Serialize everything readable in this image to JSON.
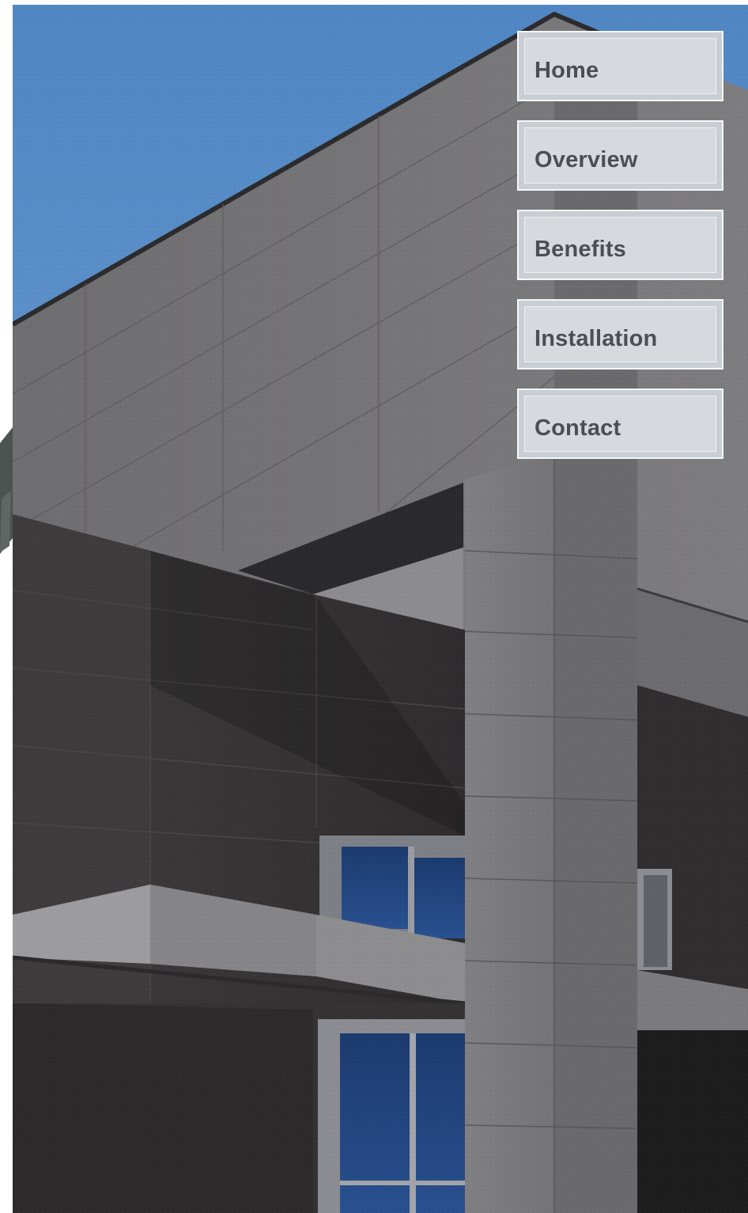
{
  "nav": {
    "items": [
      {
        "id": "home",
        "label": "Home"
      },
      {
        "id": "overview",
        "label": "Overview"
      },
      {
        "id": "benefits",
        "label": "Benefits"
      },
      {
        "id": "installation",
        "label": "Installation"
      },
      {
        "id": "contact",
        "label": "Contact"
      }
    ]
  },
  "colors": {
    "sky": "#5b8fc8",
    "facade_light": "#77777a",
    "facade_dark": "#3a3838",
    "nav_background": "#d6dadf",
    "nav_text": "#4a4f55"
  }
}
